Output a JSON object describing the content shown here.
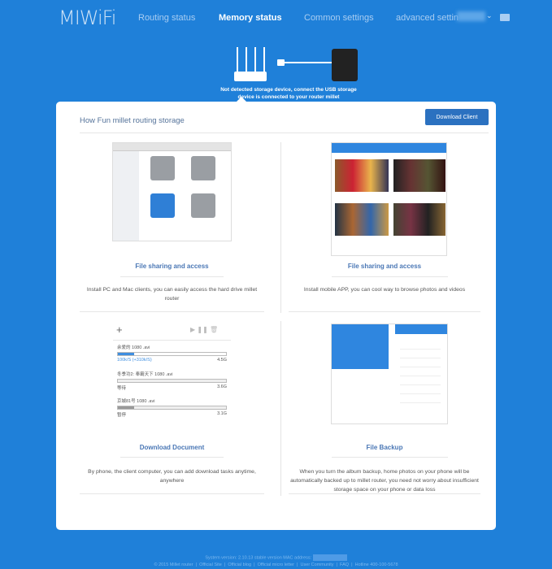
{
  "header": {
    "logo": "MIWiFi",
    "nav": [
      {
        "label": "Routing status"
      },
      {
        "label": "Memory status",
        "active": true
      },
      {
        "label": "Common settings"
      },
      {
        "label": "advanced settin"
      }
    ],
    "icons": [
      "chevron-down-icon",
      "mail-icon"
    ]
  },
  "banner": {
    "caption": "Not detected storage device, connect the USB storage device is connected to your router millet"
  },
  "card": {
    "title": "How Fun millet routing storage",
    "download_button": "Download Client",
    "features": [
      {
        "title": "File sharing and access",
        "desc": "Install PC and Mac clients, you can easily access the hard drive millet router"
      },
      {
        "title": "File sharing and access",
        "desc": "Install mobile APP, you can cool way to browse photos and videos"
      },
      {
        "title": "Download Document",
        "desc": "By phone, the client computer, you can add download tasks anytime, anywhere"
      },
      {
        "title": "File Backup",
        "desc": "When you turn the album backup, home photos on your phone will be automatically backed up to millet router, you need not worry about insufficient storage space on your phone or data loss"
      }
    ],
    "downloads": [
      {
        "name": "余爱的 1080 .avi",
        "status": "100k/S (+310k/S)",
        "size": "4.5G",
        "progress": 0.15
      },
      {
        "name": "冬季功2: 奉霸天下 1080 .avi",
        "status": "等待",
        "size": "3.6G",
        "progress": 0
      },
      {
        "name": "京城81号 1080 .avi",
        "status": "暂停",
        "size": "3.1G",
        "progress": 0.15
      }
    ]
  },
  "footer": {
    "system": "System version: 2.10.13 stable version MAC address:",
    "links": [
      "© 2015 Millet router",
      "Official Site",
      "Official blog",
      "Official micro letter",
      "User Community",
      "FAQ",
      "Hotline 400-100-5678"
    ]
  },
  "colors": {
    "background": "#1f80d9",
    "button": "#2b71c0",
    "feature_title": "#4a77b5"
  }
}
